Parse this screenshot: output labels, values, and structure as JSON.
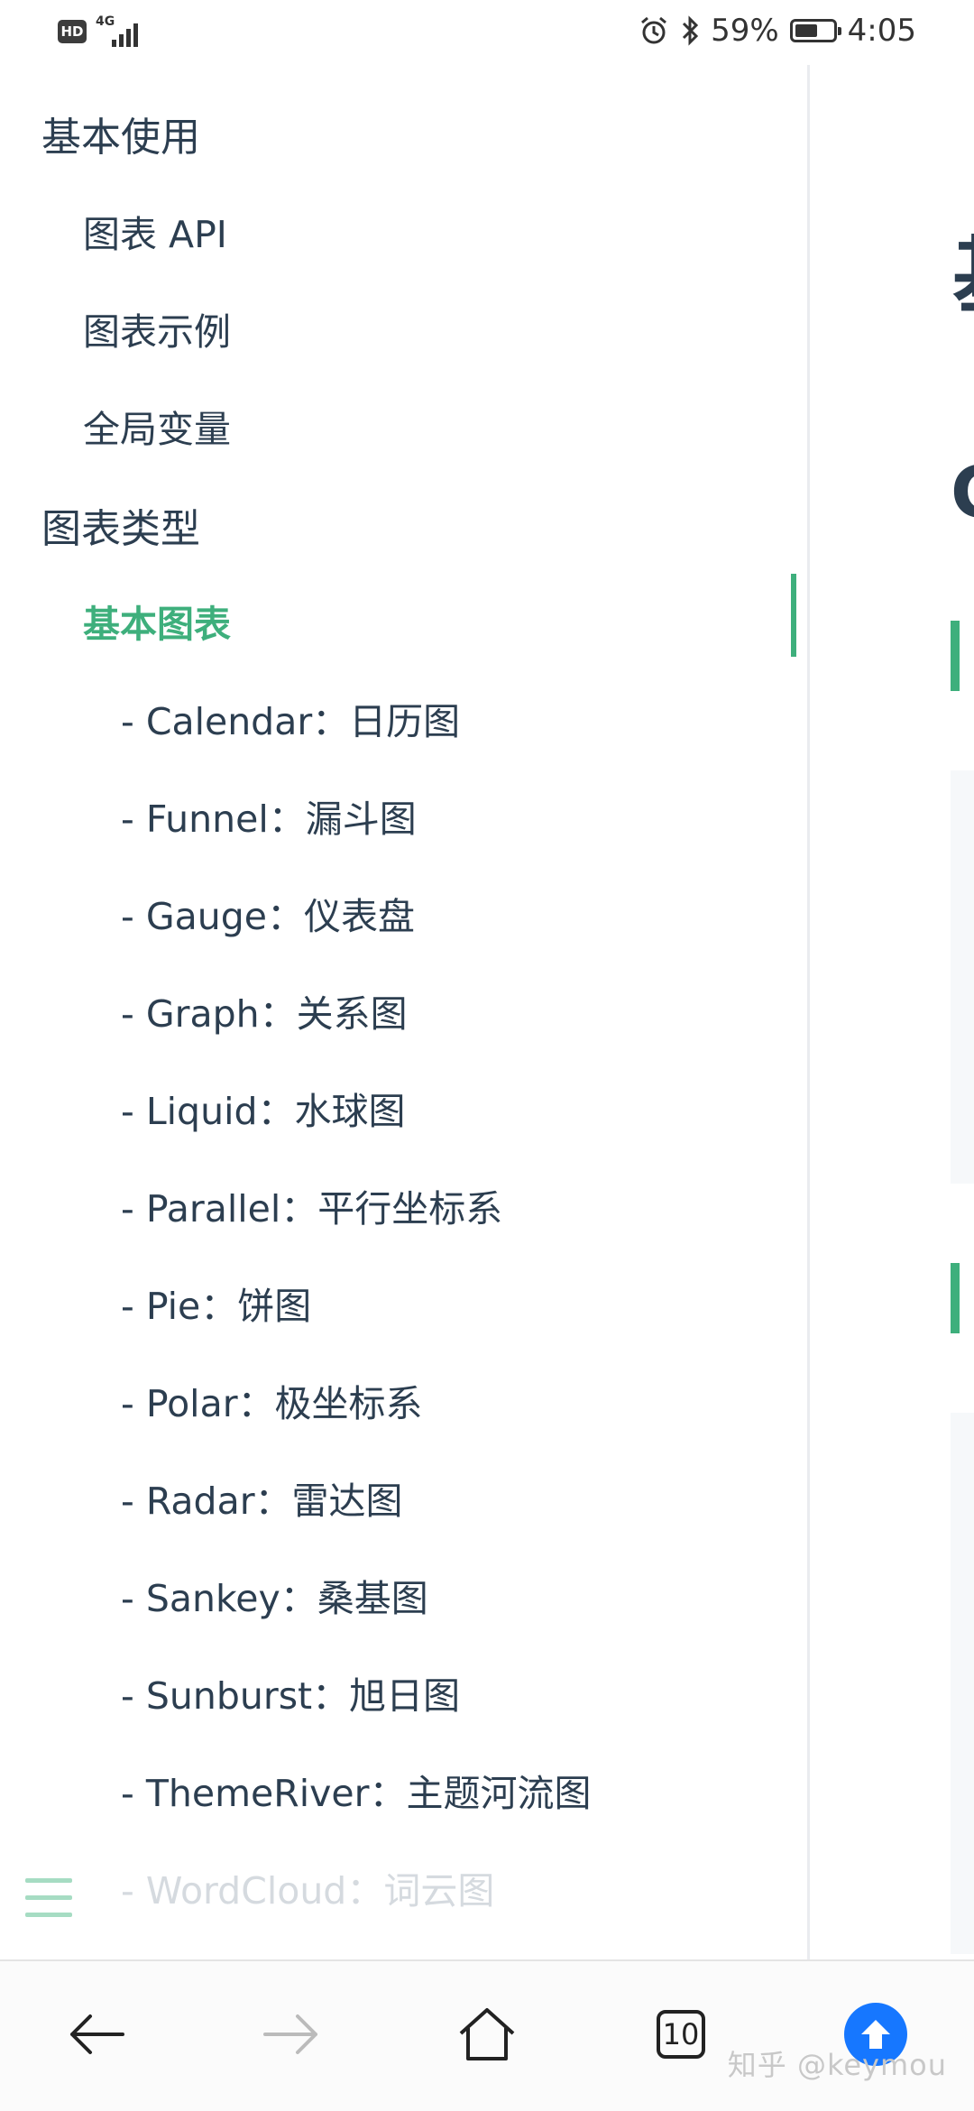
{
  "status": {
    "left_badge": "HD",
    "network": "4G",
    "battery_percent_label": "59%",
    "battery_level": 0.59,
    "time": "4:05",
    "icons": [
      "alarm-icon",
      "bluetooth-icon",
      "battery-icon"
    ]
  },
  "sidebar": {
    "groups": [
      {
        "title": "基本使用",
        "items": [
          "图表 API",
          "图表示例",
          "全局变量"
        ]
      },
      {
        "title": "图表类型",
        "active_item": "基本图表",
        "sub_items": [
          "- Calendar：日历图",
          "- Funnel：漏斗图",
          "- Gauge：仪表盘",
          "- Graph：关系图",
          "- Liquid：水球图",
          "- Parallel：平行坐标系",
          "- Pie：饼图",
          "- Polar：极坐标系",
          "- Radar：雷达图",
          "- Sankey：桑基图",
          "- Sunburst：旭日图",
          "- ThemeRiver：主题河流图",
          "- WordCloud：词云图"
        ]
      }
    ]
  },
  "content_peek": {
    "heading_glyph": "基",
    "subheading_letter": "C"
  },
  "bottom_bar": {
    "tabs_count": "10",
    "watermark": "知乎 @keymou"
  },
  "colors": {
    "accent": "#3eaf7c",
    "text": "#2c3e50",
    "up_button": "#1677ff"
  }
}
